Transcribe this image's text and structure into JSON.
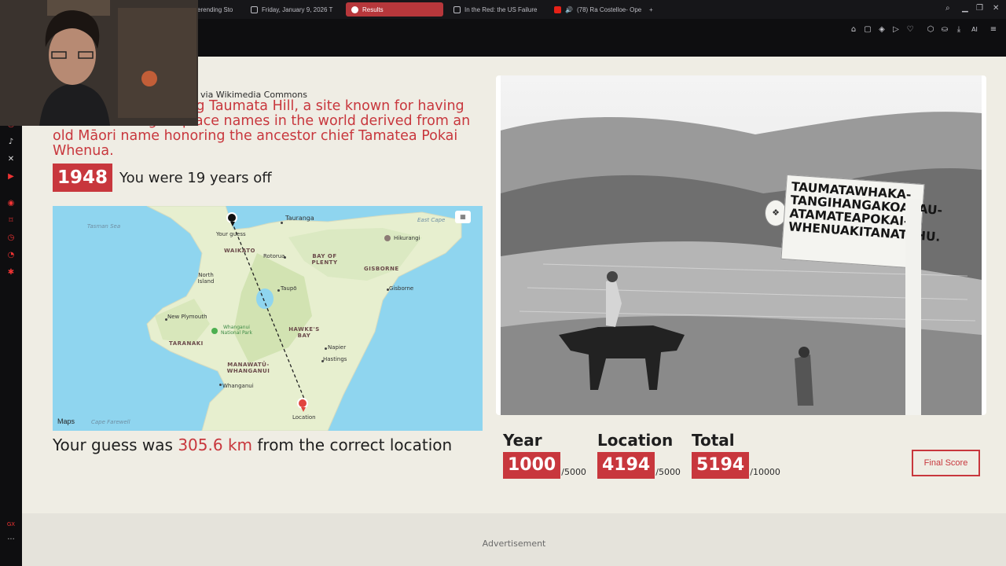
{
  "browser": {
    "tabs": [
      {
        "label": "erending Sto",
        "active": false
      },
      {
        "label": "Friday, January 9, 2026 T",
        "active": false
      },
      {
        "label": "Results",
        "active": true
      },
      {
        "label": "In the Red: the US Failure",
        "active": false
      },
      {
        "label": "(78) Ra Costelloe- Ope",
        "active": false
      }
    ],
    "new_tab": "+",
    "toolbar_ai": "AI"
  },
  "page": {
    "credit": "via Wikimedia Commons",
    "caption": "beside a sign marking Taumata Hill, a site known for having one of the longest place names in the world derived from an old Māori name honoring the ancestor chief Tamatea Pokai Whenua.",
    "year": "1948",
    "year_result": "You were 19 years off",
    "map": {
      "labels": {
        "tasman_sea": "Tasman Sea",
        "your_guess": "Your guess",
        "tauranga": "Tauranga",
        "east_cape": "East Cape",
        "hikurangi": "Hikurangi",
        "waikato": "WAIKATO",
        "rotorua": "Rotorua",
        "bay_of_plenty": "BAY OF PLENTY",
        "gisborne_region": "GISBORNE",
        "north_island": "North Island",
        "taupo": "Taupō",
        "gisborne": "Gisborne",
        "new_plymouth": "New Plymouth",
        "whanganui_park": "Whanganui National Park",
        "taranaki": "TARANAKI",
        "hawkes_bay": "HAWKE'S BAY",
        "napier": "Napier",
        "hastings": "Hastings",
        "manawatu": "MANAWATŪ-WHANGANUI",
        "whanganui": "Whanganui",
        "location": "Location",
        "cape_farewell": "Cape Farewell",
        "maps_brand": "Maps"
      }
    },
    "distance_prefix": "Your guess was ",
    "distance_value": "305.6 km",
    "distance_suffix": " from the correct location",
    "photo": {
      "sign_lines": [
        "TAUMATAWHAKA-",
        "TANGIHANGAKOAUAU-",
        "ATAMATEAPOKAI-",
        "WHENUAKITANATAHU."
      ]
    },
    "scores": [
      {
        "label": "Year",
        "value": "1000",
        "max": "/5000"
      },
      {
        "label": "Location",
        "value": "4194",
        "max": "/5000"
      },
      {
        "label": "Total",
        "value": "5194",
        "max": "/10000"
      }
    ],
    "final_button": "Final Score",
    "advertisement": "Advertisement"
  },
  "colors": {
    "accent": "#c8373d",
    "page_bg": "#efede4",
    "water": "#8fd5ef"
  },
  "icons": [
    "search-icon",
    "minimize-icon",
    "restore-icon",
    "close-icon",
    "pin-icon",
    "screenshot-icon",
    "shield-icon",
    "play-icon",
    "heart-icon",
    "extensions-icon",
    "wallet-icon",
    "download-icon",
    "menu-icon"
  ]
}
